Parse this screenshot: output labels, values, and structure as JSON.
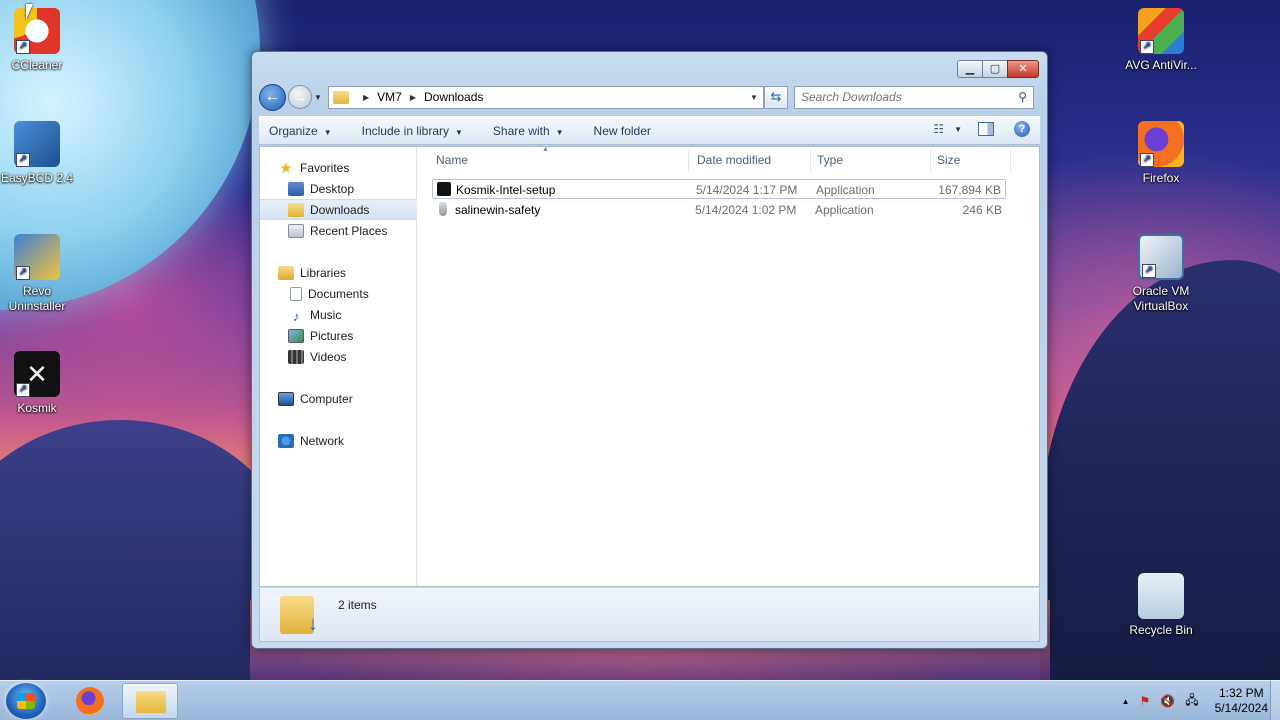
{
  "desktop": {
    "icons_left": [
      {
        "label": "CCleaner",
        "icon": "ccleaner-icon"
      },
      {
        "label": "EasyBCD 2.4",
        "icon": "easybcd-icon"
      },
      {
        "label": "Revo Uninstaller",
        "icon": "revo-icon"
      },
      {
        "label": "Kosmik",
        "icon": "kosmik-icon"
      }
    ],
    "icons_right": [
      {
        "label": "AVG AntiVir...",
        "icon": "avg-icon"
      },
      {
        "label": "Firefox",
        "icon": "firefox-icon"
      },
      {
        "label": "Oracle VM VirtualBox",
        "icon": "virtualbox-icon"
      },
      {
        "label": "Recycle Bin",
        "icon": "recycle-bin-icon"
      }
    ]
  },
  "window": {
    "caption_buttons": {
      "minimize": "▁",
      "maximize": "▢",
      "close": "✕"
    },
    "address": {
      "segments": [
        "VM7",
        "Downloads"
      ]
    },
    "search": {
      "placeholder": "Search Downloads"
    },
    "toolbar": {
      "organize": "Organize",
      "include_in_library": "Include in library",
      "share_with": "Share with",
      "new_folder": "New folder"
    },
    "nav_pane": {
      "favorites": "Favorites",
      "desktop": "Desktop",
      "downloads": "Downloads",
      "recent_places": "Recent Places",
      "libraries": "Libraries",
      "documents": "Documents",
      "music": "Music",
      "pictures": "Pictures",
      "videos": "Videos",
      "computer": "Computer",
      "network": "Network",
      "selected": "Downloads"
    },
    "columns": {
      "name": "Name",
      "date_modified": "Date modified",
      "type": "Type",
      "size": "Size"
    },
    "files": [
      {
        "name": "Kosmik-Intel-setup",
        "date": "5/14/2024 1:17 PM",
        "type": "Application",
        "size": "167,894 KB",
        "icon": "kosmik-setup-icon"
      },
      {
        "name": "salinewin-safety",
        "date": "5/14/2024 1:02 PM",
        "type": "Application",
        "size": "246 KB",
        "icon": "salinewin-icon"
      }
    ],
    "details": {
      "item_count": "2 items"
    }
  },
  "taskbar": {
    "clock_time": "1:32 PM",
    "clock_date": "5/14/2024"
  }
}
